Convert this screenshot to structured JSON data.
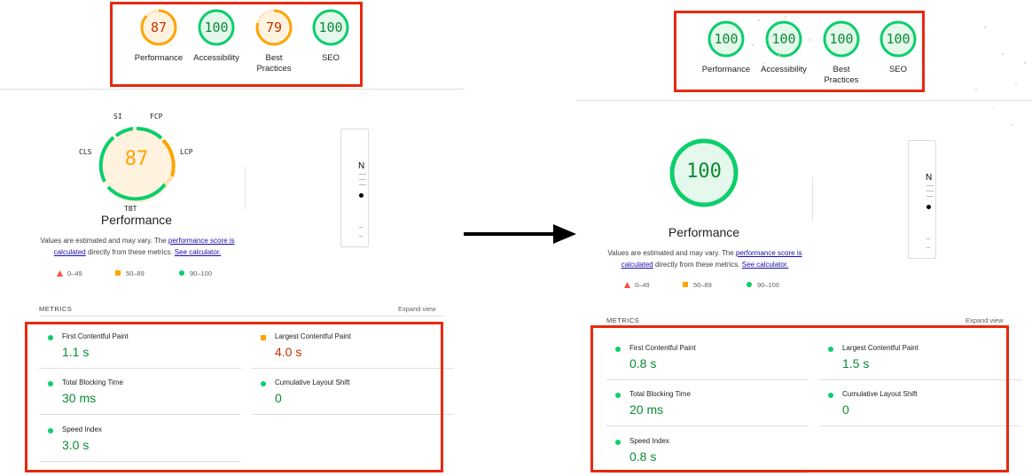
{
  "colors": {
    "good": "#0cce6b",
    "good_text": "#0c8a35",
    "average": "#ffa400",
    "average_text": "#c33300",
    "poor": "#ff4e42",
    "highlight_box": "#e8290f"
  },
  "before": {
    "scores": [
      {
        "value": "87",
        "label": "Performance",
        "score": 87,
        "rating": "average"
      },
      {
        "value": "100",
        "label": "Accessibility",
        "score": 100,
        "rating": "good"
      },
      {
        "value": "79",
        "label": "Best\nPractices",
        "score": 79,
        "rating": "average"
      },
      {
        "value": "100",
        "label": "SEO",
        "score": 100,
        "rating": "good"
      }
    ],
    "gauge": {
      "value": "87",
      "title": "Performance",
      "segment_labels": {
        "si": "SI",
        "fcp": "FCP",
        "lcp": "LCP",
        "tbt": "TBT",
        "cls": "CLS"
      }
    },
    "metrics": [
      {
        "name": "First Contentful Paint",
        "value": "1.1 s",
        "rating": "good"
      },
      {
        "name": "Largest Contentful Paint",
        "value": "4.0 s",
        "rating": "average"
      },
      {
        "name": "Total Blocking Time",
        "value": "30 ms",
        "rating": "good"
      },
      {
        "name": "Cumulative Layout Shift",
        "value": "0",
        "rating": "good"
      },
      {
        "name": "Speed Index",
        "value": "3.0 s",
        "rating": "good"
      }
    ]
  },
  "after": {
    "scores": [
      {
        "value": "100",
        "label": "Performance",
        "score": 100,
        "rating": "good"
      },
      {
        "value": "100",
        "label": "Accessibility",
        "score": 100,
        "rating": "good"
      },
      {
        "value": "100",
        "label": "Best\nPractices",
        "score": 100,
        "rating": "good"
      },
      {
        "value": "100",
        "label": "SEO",
        "score": 100,
        "rating": "good"
      }
    ],
    "gauge": {
      "value": "100",
      "title": "Performance"
    },
    "metrics": [
      {
        "name": "First Contentful Paint",
        "value": "0.8 s",
        "rating": "good"
      },
      {
        "name": "Largest Contentful Paint",
        "value": "1.5 s",
        "rating": "good"
      },
      {
        "name": "Total Blocking Time",
        "value": "20 ms",
        "rating": "good"
      },
      {
        "name": "Cumulative Layout Shift",
        "value": "0",
        "rating": "good"
      },
      {
        "name": "Speed Index",
        "value": "0.8 s",
        "rating": "good"
      }
    ]
  },
  "description": {
    "prefix": "Values are estimated and may vary. The ",
    "link1": "performance score is calculated",
    "middle": " directly from these metrics. ",
    "link2": "See calculator."
  },
  "legend": [
    {
      "icon": "triangle",
      "range": "0–49"
    },
    {
      "icon": "square",
      "range": "50–89"
    },
    {
      "icon": "circle",
      "range": "90–100"
    }
  ],
  "metrics_header": "METRICS",
  "expand_view": "Expand view",
  "thumbnail": {
    "letter": "N"
  },
  "arrow_icon": "right-arrow-icon"
}
